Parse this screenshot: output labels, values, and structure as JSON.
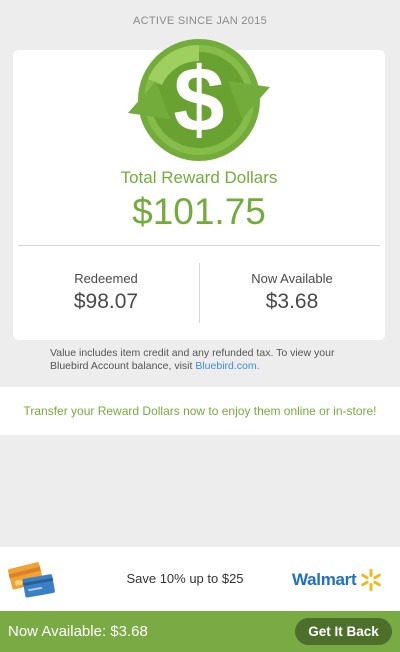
{
  "header": {
    "active_since": "ACTIVE SINCE JAN 2015"
  },
  "rewards": {
    "total_label": "Total Reward Dollars",
    "total_value": "$101.75",
    "redeemed_label": "Redeemed",
    "redeemed_value": "$98.07",
    "available_label": "Now Available",
    "available_value": "$3.68"
  },
  "note": {
    "text": "Value includes item credit and any refunded tax. To view your Bluebird Account balance, visit ",
    "link": "Bluebird.com."
  },
  "transfer": {
    "text": "Transfer your Reward Dollars now to enjoy them online or in-store!"
  },
  "ad": {
    "text": "Save 10% up to $25",
    "brand": "Walmart",
    "icons": [
      "cards-icon",
      "walmart-spark-icon"
    ]
  },
  "bottom_bar": {
    "available_text": "Now Available: $3.68",
    "button_label": "Get It Back"
  },
  "icons": [
    "dollar-cycle-icon"
  ],
  "colors": {
    "accent_green": "#74ac3c",
    "bar_green": "#79aa44",
    "button_dark_green": "#4c6f2c",
    "link_blue": "#3d8fd8",
    "walmart_blue": "#1f6ec9",
    "walmart_yellow": "#f8b51a"
  }
}
